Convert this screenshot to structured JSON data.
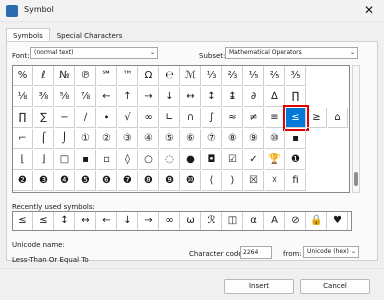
{
  "window": {
    "title": "Symbol",
    "close_glyph": "✕"
  },
  "tabs": [
    {
      "label": "Symbols",
      "active": true
    },
    {
      "label": "Special Characters",
      "active": false
    }
  ],
  "font": {
    "label": "Font:",
    "value": "(normal text)"
  },
  "subset": {
    "label": "Subset:",
    "value": "Mathematical Operators"
  },
  "grid": {
    "rows": [
      [
        "%",
        "ℓ",
        "№",
        "℗",
        "℠",
        "™",
        "Ω",
        "℮",
        "ℳ",
        "⅓",
        "⅔",
        "⅕",
        "⅖",
        "⅗"
      ],
      [
        "⅛",
        "⅜",
        "⅝",
        "⅞",
        "←",
        "↑",
        "→",
        "↓",
        "↔",
        "↕",
        "↨",
        "∂",
        "∆",
        "∏"
      ],
      [
        "∏",
        "∑",
        "−",
        "∕",
        "∙",
        "√",
        "∞",
        "∟",
        "∩",
        "∫",
        "≈",
        "≠",
        "≡",
        "≤",
        "≥",
        "⌂"
      ],
      [
        "⌐",
        "⌠",
        "⌡",
        "①",
        "②",
        "③",
        "④",
        "⑤",
        "⑥",
        "⑦",
        "⑧",
        "⑨",
        "⑩",
        "▪"
      ],
      [
        "⌊",
        "⌋",
        "□",
        "▪",
        "▫",
        "◊",
        "○",
        "◌",
        "●",
        "◘",
        "☑",
        "✓",
        "🏆",
        "❶"
      ],
      [
        "❷",
        "❸",
        "❹",
        "❺",
        "❻",
        "❼",
        "❽",
        "❾",
        "❿",
        "⟨",
        "⟩",
        "☒",
        "☓",
        "ﬁ"
      ]
    ],
    "selected_char": "≤"
  },
  "recent": {
    "label": "Recently used symbols:",
    "items": [
      "≤",
      "≤",
      "↕",
      "↔",
      "←",
      "↓",
      "→",
      "∞",
      "ω",
      "ℛ",
      "◫",
      "α",
      "A",
      "⊘",
      "🔒",
      "♥"
    ]
  },
  "unicode": {
    "label": "Unicode name:",
    "value": "Less-Than Or Equal To"
  },
  "charcode": {
    "label": "Character code:",
    "value": "2264"
  },
  "from": {
    "label": "from:",
    "value": "Unicode (hex)"
  },
  "buttons": {
    "insert": "Insert",
    "cancel": "Cancel"
  },
  "colors": {
    "selected": "#0078d7",
    "highlight": "#e00000"
  }
}
